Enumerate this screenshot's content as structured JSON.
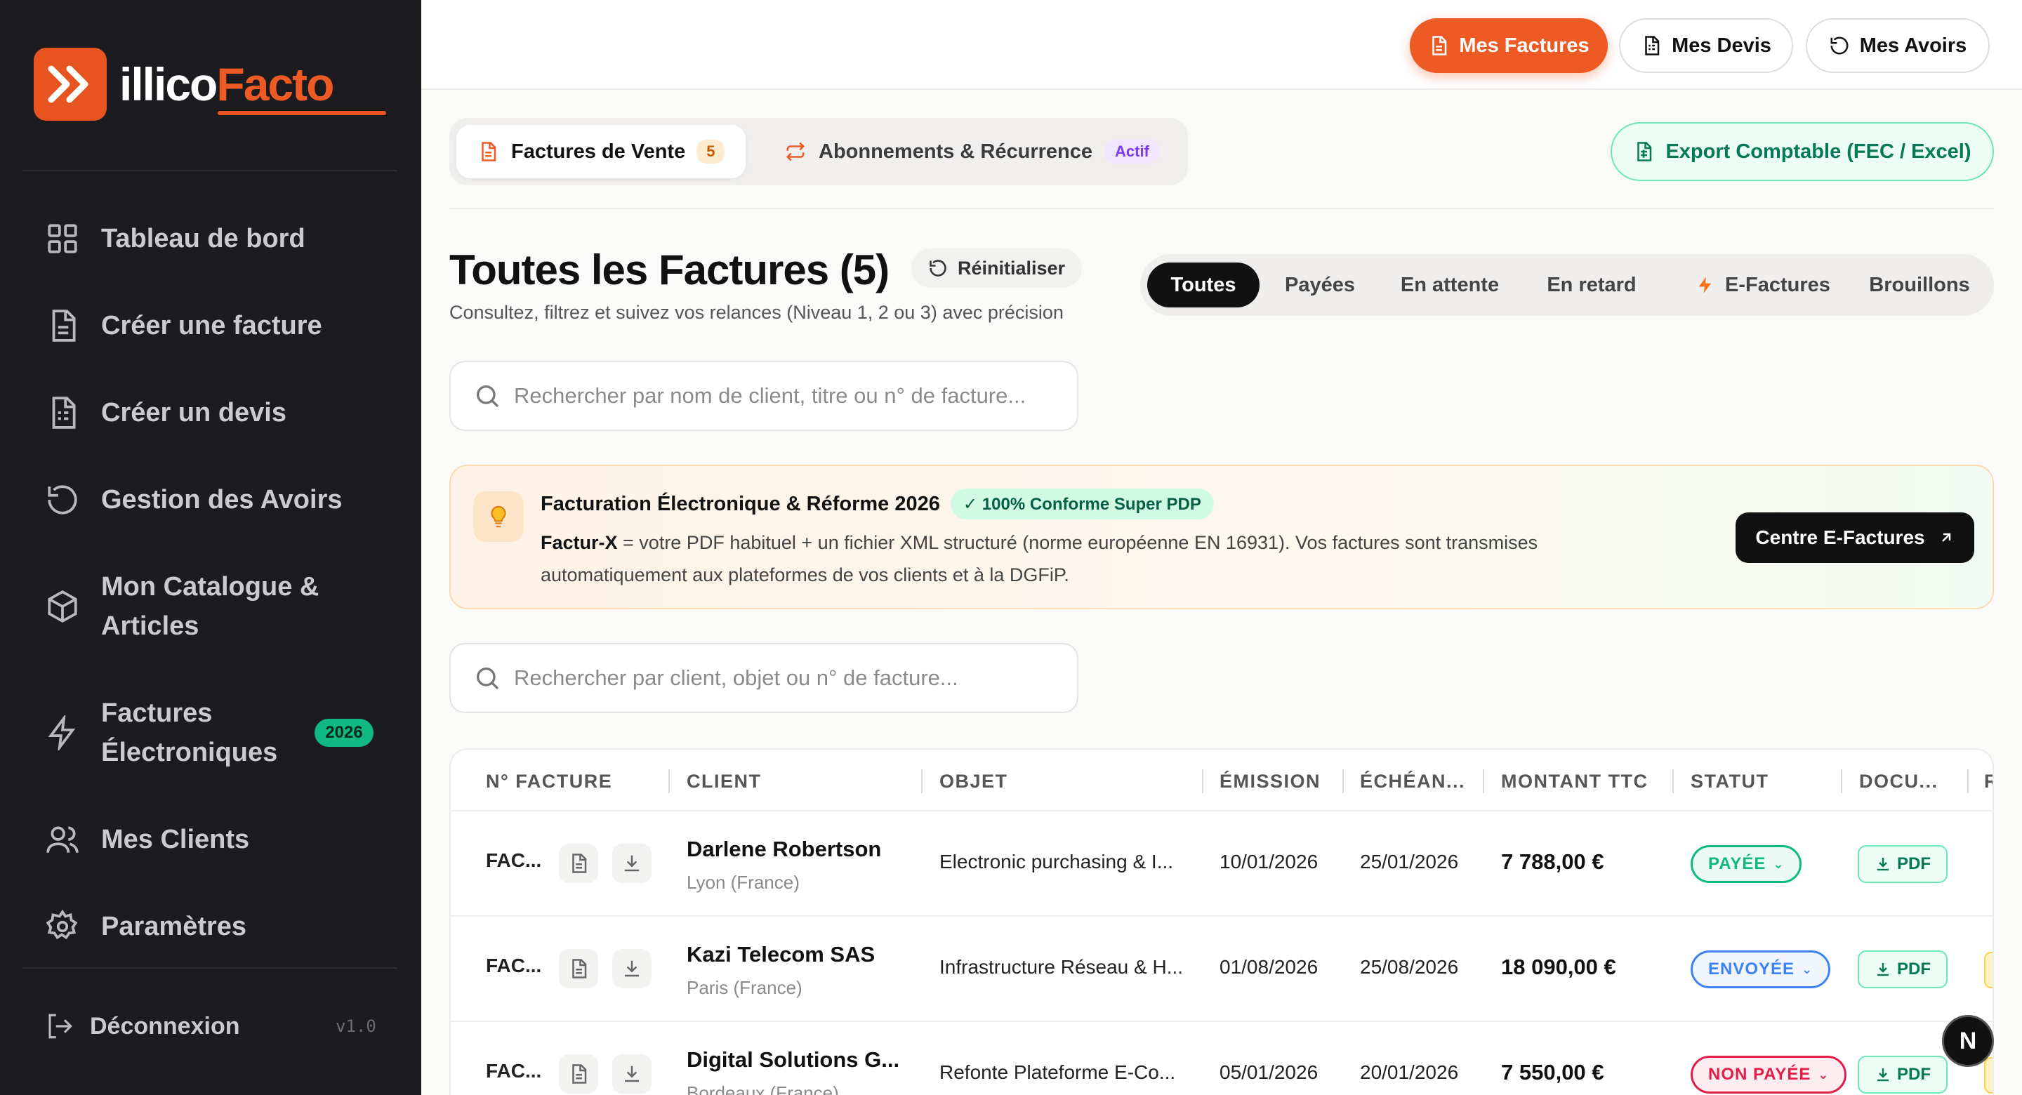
{
  "brand": {
    "name_part1": "illico",
    "name_part2": "Facto"
  },
  "sidebar": {
    "items": [
      {
        "label": "Tableau de bord",
        "icon": "grid-icon"
      },
      {
        "label": "Créer une facture",
        "icon": "document-icon"
      },
      {
        "label": "Créer un devis",
        "icon": "document-list-icon"
      },
      {
        "label": "Gestion des Avoirs",
        "icon": "undo-icon"
      },
      {
        "label": "Mon Catalogue & Articles",
        "icon": "box-icon"
      },
      {
        "label": "Factures Électroniques",
        "icon": "lightning-icon",
        "badge": "2026"
      },
      {
        "label": "Mes Clients",
        "icon": "users-icon"
      },
      {
        "label": "Paramètres",
        "icon": "gear-icon"
      }
    ],
    "logout": "Déconnexion",
    "version": "v1.0"
  },
  "topbar": {
    "buttons": [
      {
        "label": "Mes Factures",
        "active": true
      },
      {
        "label": "Mes Devis",
        "active": false
      },
      {
        "label": "Mes Avoirs",
        "active": false
      }
    ]
  },
  "subtabs": {
    "sales": {
      "label": "Factures de Vente",
      "count": "5"
    },
    "subscriptions": {
      "label": "Abonnements & Récurrence",
      "badge": "Actif"
    }
  },
  "export_button": "Export Comptable (FEC / Excel)",
  "page": {
    "title": "Toutes les Factures (5)",
    "reset": "Réinitialiser",
    "subtitle": "Consultez, filtrez et suivez vos relances (Niveau 1, 2 ou 3) avec précision"
  },
  "filters": [
    "Toutes",
    "Payées",
    "En attente",
    "En retard",
    "E-Factures",
    "Brouillons"
  ],
  "search1": {
    "placeholder": "Rechercher par nom de client, titre ou n° de facture..."
  },
  "search2": {
    "placeholder": "Rechercher par client, objet ou n° de facture..."
  },
  "banner": {
    "title": "Facturation Électronique & Réforme 2026",
    "badge": "✓ 100% Conforme Super PDP",
    "text_bold": "Factur-X",
    "text": " = votre PDF habituel + un fichier XML structuré (norme européenne EN 16931). Vos factures sont transmises automatiquement aux plateformes de vos clients et à la DGFiP.",
    "button": "Centre E-Factures"
  },
  "table": {
    "headers": [
      "N° FACTURE",
      "CLIENT",
      "OBJET",
      "ÉMISSION",
      "ÉCHÉAN...",
      "MONTANT TTC",
      "STATUT",
      "DOCU...",
      "R"
    ],
    "rows": [
      {
        "num": "FAC...",
        "client": "Darlene Robertson",
        "city": "Lyon (France)",
        "object": "Electronic purchasing & I...",
        "emission": "10/01/2026",
        "due": "25/01/2026",
        "amount": "7 788,00 €",
        "status": "PAYÉE",
        "status_color": "#10b981",
        "pdf": "PDF"
      },
      {
        "num": "FAC...",
        "client": "Kazi Telecom SAS",
        "city": "Paris (France)",
        "object": "Infrastructure Réseau & H...",
        "emission": "01/08/2026",
        "due": "25/08/2026",
        "amount": "18 090,00 €",
        "status": "ENVOYÉE",
        "status_color": "#3b82f6",
        "pdf": "PDF"
      },
      {
        "num": "FAC...",
        "client": "Digital Solutions G...",
        "city": "Bordeaux (France)",
        "object": "Refonte Plateforme E-Co...",
        "emission": "05/01/2026",
        "due": "20/01/2026",
        "amount": "7 550,00 €",
        "status": "NON PAYÉE",
        "status_color": "#e11d48",
        "pdf": "PDF"
      }
    ]
  },
  "assistant_bubble": "N",
  "colors": {
    "accent": "#ee5a24",
    "sidebar_bg": "#1c1b1f",
    "success": "#10b981"
  }
}
